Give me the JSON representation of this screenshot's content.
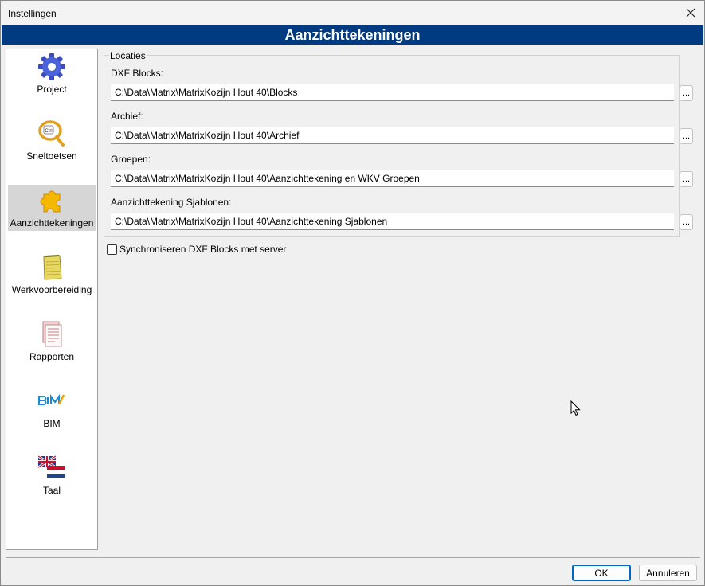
{
  "window": {
    "title": "Instellingen"
  },
  "banner": {
    "title": "Aanzichttekeningen"
  },
  "sidebar": {
    "items": [
      {
        "label": "Project",
        "icon": "gear-icon"
      },
      {
        "label": "Sneltoetsen",
        "icon": "key-icon"
      },
      {
        "label": "Aanzichttekeningen",
        "icon": "puzzle-icon",
        "selected": true
      },
      {
        "label": "Werkvoorbereiding",
        "icon": "notepad-icon"
      },
      {
        "label": "Rapporten",
        "icon": "report-icon"
      },
      {
        "label": "BIM",
        "icon": "bim-logo-icon"
      },
      {
        "label": "Taal",
        "icon": "flags-icon"
      }
    ]
  },
  "locaties": {
    "legend": "Locaties",
    "fields": [
      {
        "label": "DXF Blocks:",
        "value": "C:\\Data\\Matrix\\MatrixKozijn Hout 40\\Blocks",
        "browse": "..."
      },
      {
        "label": "Archief:",
        "value": "C:\\Data\\Matrix\\MatrixKozijn Hout 40\\Archief",
        "browse": "..."
      },
      {
        "label": "Groepen:",
        "value": "C:\\Data\\Matrix\\MatrixKozijn Hout 40\\Aanzichttekening en WKV Groepen",
        "browse": "..."
      },
      {
        "label": "Aanzichttekening Sjablonen:",
        "value": "C:\\Data\\Matrix\\MatrixKozijn Hout 40\\Aanzichttekening Sjablonen",
        "browse": "..."
      }
    ]
  },
  "sync": {
    "label": "Synchroniseren DXF Blocks met server",
    "checked": false
  },
  "buttons": {
    "ok": "OK",
    "cancel": "Annuleren"
  }
}
